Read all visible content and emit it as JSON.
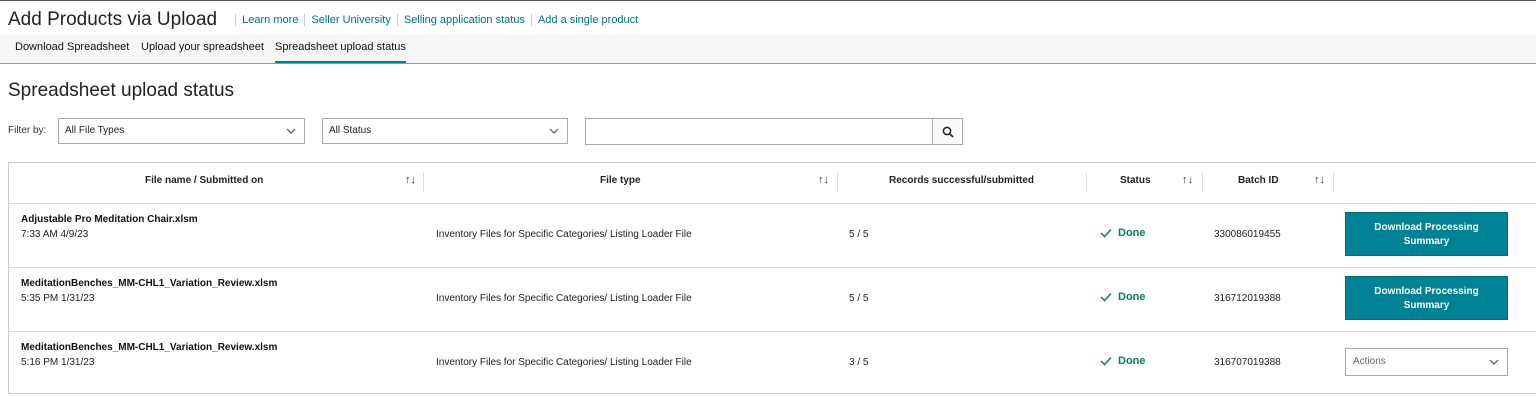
{
  "header": {
    "title": "Add Products via Upload",
    "links": [
      "Learn more",
      "Seller University",
      "Selling application status",
      "Add a single product"
    ]
  },
  "tabs": [
    {
      "label": "Download Spreadsheet",
      "active": false
    },
    {
      "label": "Upload your spreadsheet",
      "active": false
    },
    {
      "label": "Spreadsheet upload status",
      "active": true
    }
  ],
  "section_title": "Spreadsheet upload status",
  "filters": {
    "label": "Filter by:",
    "file_type": "All File Types",
    "status": "All Status",
    "search_value": ""
  },
  "table": {
    "headers": [
      "File name / Submitted on",
      "File type",
      "Records successful/submitted",
      "Status",
      "Batch ID"
    ],
    "rows": [
      {
        "file_name": "Adjustable Pro Meditation Chair.xlsm",
        "submitted_on": "7:33 AM 4/9/23",
        "file_type": "Inventory Files for Specific Categories/ Listing Loader File",
        "records": "5 / 5",
        "status": "Done",
        "batch_id": "330086019455",
        "action": "Download Processing Summary"
      },
      {
        "file_name": "MeditationBenches_MM-CHL1_Variation_Review.xlsm",
        "submitted_on": "5:35 PM 1/31/23",
        "file_type": "Inventory Files for Specific Categories/ Listing Loader File",
        "records": "5 / 5",
        "status": "Done",
        "batch_id": "316712019388",
        "action": "Download Processing Summary"
      },
      {
        "file_name": "MeditationBenches_MM-CHL1_Variation_Review.xlsm",
        "submitted_on": "5:16 PM 1/31/23",
        "file_type": "Inventory Files for Specific Categories/ Listing Loader File",
        "records": "3 / 5",
        "status": "Done",
        "batch_id": "316707019388",
        "action": "Actions"
      }
    ]
  },
  "colors": {
    "accent": "#008296",
    "link": "#007185",
    "success": "#067d62"
  },
  "icons": {
    "search": "search-icon",
    "dropdown": "chevron-down-icon",
    "sort": "sort-icon",
    "done": "checkmark-icon"
  }
}
